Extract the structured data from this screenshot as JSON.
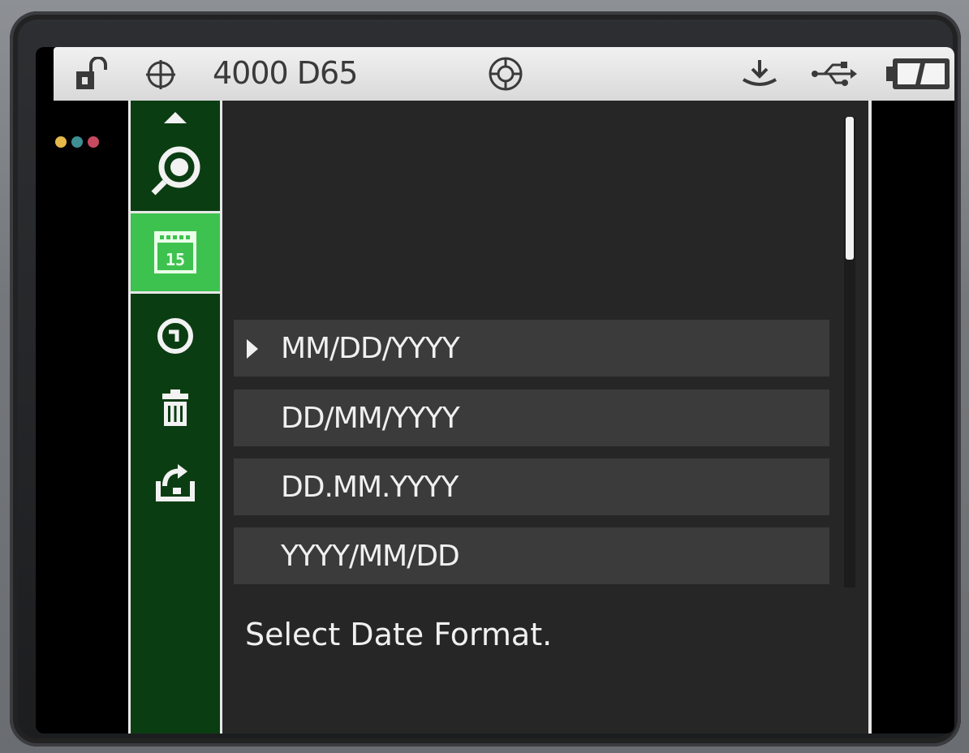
{
  "status_bar": {
    "mode_text": "4000 D65",
    "icons": [
      "unlock-icon",
      "target-crosshair-icon",
      "aperture-icon",
      "tray-download-icon",
      "usb-icon",
      "battery-icon"
    ]
  },
  "indicator_dots": {
    "colors": [
      "#e5b84a",
      "#3e8f93",
      "#c54a60"
    ]
  },
  "sidebar": {
    "items": [
      {
        "icon": "magnifier-icon"
      },
      {
        "icon": "calendar-icon",
        "badge": "15",
        "active": true
      },
      {
        "icon": "clock-icon"
      },
      {
        "icon": "trash-icon"
      },
      {
        "icon": "export-icon"
      }
    ],
    "colors": {
      "background": "#0b3d12",
      "active": "#3ec24f"
    }
  },
  "date_format_menu": {
    "options": [
      {
        "label": "MM/DD/YYYY",
        "selected": true
      },
      {
        "label": "DD/MM/YYYY"
      },
      {
        "label": "DD.MM.YYYY"
      },
      {
        "label": "YYYY/MM/DD"
      }
    ],
    "hint": "Select Date Format."
  }
}
